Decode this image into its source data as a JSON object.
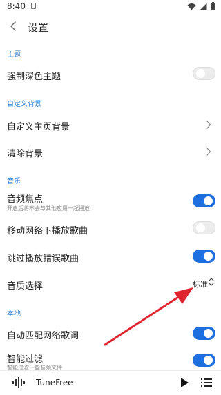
{
  "status_bar": {
    "time": "8:40"
  },
  "header": {
    "title": "设置"
  },
  "sections": {
    "theme": {
      "header": "主题",
      "force_dark": {
        "label": "强制深色主题",
        "enabled": false
      }
    },
    "custom_background": {
      "header": "自定义背景",
      "home_background": {
        "label": "自定义主页背景"
      },
      "clear_background": {
        "label": "清除背景"
      }
    },
    "music": {
      "header": "音乐",
      "audio_focus": {
        "label": "音频焦点",
        "subtitle": "开启后将不会与其他应用一起播放",
        "enabled": true
      },
      "mobile_network_playback": {
        "label": "移动网络下播放歌曲",
        "enabled": false
      },
      "skip_error_songs": {
        "label": "跳过播放错误歌曲",
        "enabled": true
      },
      "audio_quality": {
        "label": "音质选择",
        "value": "标准"
      }
    },
    "local": {
      "header": "本地",
      "auto_match_lyrics": {
        "label": "自动匹配网络歌词",
        "enabled": true
      },
      "smart_filter": {
        "label": "智能过滤",
        "subtitle": "智能过滤一些音频文件",
        "enabled": true
      }
    }
  },
  "player_bar": {
    "song_title": "TuneFree"
  },
  "colors": {
    "accent": "#1e6fe0",
    "section_header": "#1e78d2",
    "annotation_arrow": "#e0242f"
  },
  "icons": {
    "back": "chevron-left-icon",
    "chevron": "chevron-right-icon",
    "updown": "unfold-icon",
    "play": "play-icon",
    "queue": "playlist-icon",
    "wave": "waveform-icon"
  }
}
